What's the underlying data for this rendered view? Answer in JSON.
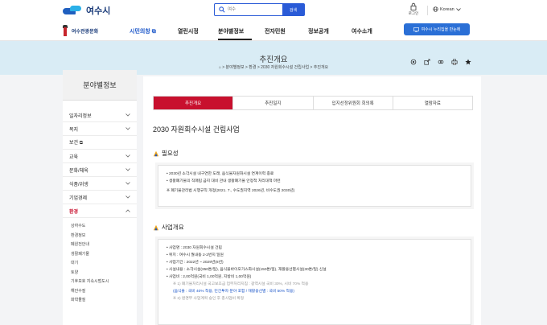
{
  "header": {
    "logo": "여수시",
    "search_placeholder": "여수",
    "search_button": "검색",
    "login": "로그인",
    "language": "Korean"
  },
  "nav": {
    "tourism": "여수관광문화",
    "items": [
      "시민의창",
      "열린시정",
      "분야별정보",
      "전자민원",
      "정보공개",
      "여수소개"
    ],
    "promo": "여수시 누리집을 만눈에"
  },
  "page": {
    "title": "추진개요",
    "breadcrumb": "⌂ > 분야별정보 > 환경 > 2030 자원회수시설 건립사업 > 추진개요"
  },
  "sidebar": {
    "title": "분야별정보",
    "items": [
      {
        "label": "일자리정보"
      },
      {
        "label": "복지"
      },
      {
        "label": "보건"
      },
      {
        "label": "교육"
      },
      {
        "label": "문화/체육"
      },
      {
        "label": "식품/위생"
      },
      {
        "label": "기업경제"
      },
      {
        "label": "환경"
      }
    ],
    "sub_items": [
      "상하수도",
      "환경정보",
      "폐원전안내",
      "생활폐기물",
      "대기",
      "토양",
      "기후보호 지속시범도시",
      "해안수질",
      "화학물질"
    ]
  },
  "main": {
    "tabs": [
      "추진개요",
      "추진일지",
      "입지선정위원회 회의록",
      "열람자료"
    ],
    "doc_title": "2030 자원회수시설 건립사업",
    "section1": {
      "heading": "필요성",
      "lines": [
        "• 2030년 소각시설 내구연한 도래, 음식물자원화시설 연계이력 종료",
        "• 생활폐기물의 직매립 금지 대비 관내 생활폐기물 안정적 처리대책 마련",
        "※ 폐기물관리법 시행규칙 개정(2021. 7., 수도권지역 2026년, 비수도권 2030년)"
      ]
    },
    "section2": {
      "heading": "사업개요",
      "lines": [
        "• 사업명 : 2030 자원회수시설 건립",
        "• 위치 : 여수시 월내동 2-2번지 일원",
        "• 사업기간 : 2022년 ~ 2029년(8년)",
        "• 시설내용 : 소각시설(350톤/일), 음식물바이오가스화시설(150톤/일), 재활용선별시설(30톤/일) 신설",
        "• 사업비 : 2,00억원(국비 1,00억원, 지방비 1,00억원)",
        "※ 1) 폐기물처리시설 국고보조금 업무처리지침 : 광역시설 국비 30%, 시비 70% 적용",
        "(음식물 : 국비 40% 적용, 민간투자 분야 포함 / 재활용선별 : 국비 50% 적용)",
        "※ 2) 환경부 사업계획 승인 후 총사업비 확정"
      ]
    }
  }
}
